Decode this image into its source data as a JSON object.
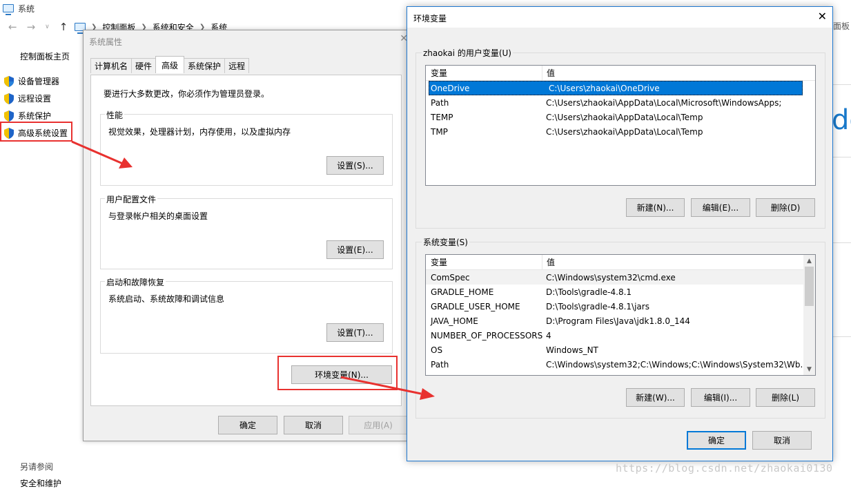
{
  "system_window": {
    "title": "系统",
    "breadcrumb": [
      "控制面板",
      "系统和安全",
      "系统"
    ],
    "breadcrumb_right": "面板",
    "control_panel_home": "控制面板主页",
    "sidebar": [
      {
        "label": "设备管理器"
      },
      {
        "label": "远程设置"
      },
      {
        "label": "系统保护"
      },
      {
        "label": "高级系统设置"
      }
    ],
    "see_also": "另请参阅",
    "security_maintenance": "安全和维护",
    "right_letters": "dc"
  },
  "system_properties": {
    "title": "系统属性",
    "tabs": [
      "计算机名",
      "硬件",
      "高级",
      "系统保护",
      "远程"
    ],
    "active_tab": 2,
    "admin_hint": "要进行大多数更改，你必须作为管理员登录。",
    "groups": [
      {
        "label": "性能",
        "desc": "视觉效果，处理器计划，内存使用，以及虚拟内存",
        "button": "设置(S)..."
      },
      {
        "label": "用户配置文件",
        "desc": "与登录帐户相关的桌面设置",
        "button": "设置(E)..."
      },
      {
        "label": "启动和故障恢复",
        "desc": "系统启动、系统故障和调试信息",
        "button": "设置(T)..."
      }
    ],
    "env_button": "环境变量(N)...",
    "ok": "确定",
    "cancel": "取消",
    "apply": "应用(A)"
  },
  "env_vars": {
    "title": "环境变量",
    "user_group_label": "zhaokai 的用户变量(U)",
    "col_var": "变量",
    "col_val": "值",
    "user_vars": [
      {
        "name": "OneDrive",
        "value": "C:\\Users\\zhaokai\\OneDrive"
      },
      {
        "name": "Path",
        "value": "C:\\Users\\zhaokai\\AppData\\Local\\Microsoft\\WindowsApps;"
      },
      {
        "name": "TEMP",
        "value": "C:\\Users\\zhaokai\\AppData\\Local\\Temp"
      },
      {
        "name": "TMP",
        "value": "C:\\Users\\zhaokai\\AppData\\Local\\Temp"
      }
    ],
    "user_buttons": {
      "new": "新建(N)...",
      "edit": "编辑(E)...",
      "delete": "删除(D)"
    },
    "system_group_label": "系统变量(S)",
    "system_vars": [
      {
        "name": "ComSpec",
        "value": "C:\\Windows\\system32\\cmd.exe"
      },
      {
        "name": "GRADLE_HOME",
        "value": "D:\\Tools\\gradle-4.8.1"
      },
      {
        "name": "GRADLE_USER_HOME",
        "value": "D:\\Tools\\gradle-4.8.1\\jars"
      },
      {
        "name": "JAVA_HOME",
        "value": "D:\\Program Files\\Java\\jdk1.8.0_144"
      },
      {
        "name": "NUMBER_OF_PROCESSORS",
        "value": "4"
      },
      {
        "name": "OS",
        "value": "Windows_NT"
      },
      {
        "name": "Path",
        "value": "C:\\Windows\\system32;C:\\Windows;C:\\Windows\\System32\\Wb..."
      }
    ],
    "system_buttons": {
      "new": "新建(W)...",
      "edit": "编辑(I)...",
      "delete": "删除(L)"
    },
    "ok": "确定",
    "cancel": "取消"
  },
  "watermark": "https://blog.csdn.net/zhaokai0130",
  "colors": {
    "selection": "#0078d7",
    "annotation": "#e8312f",
    "accent": "#1979ca"
  }
}
